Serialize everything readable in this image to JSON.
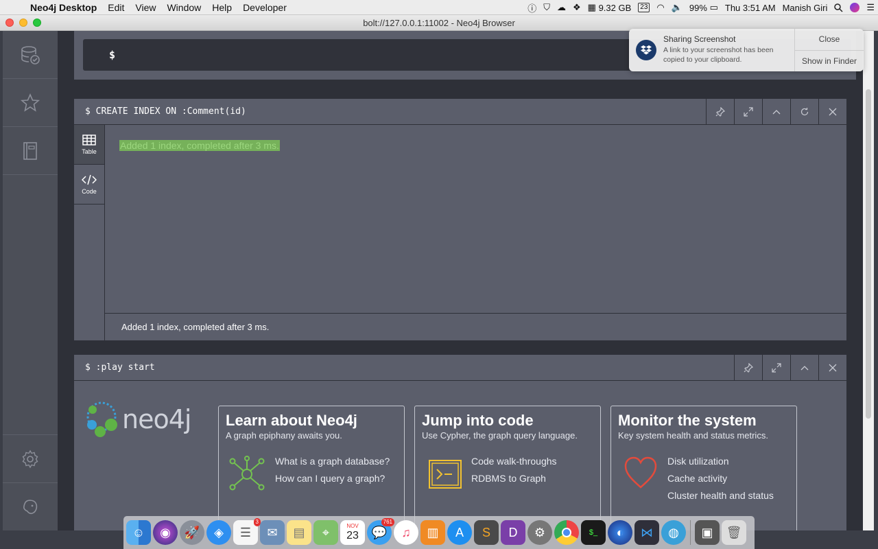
{
  "menubar": {
    "app_name": "Neo4j Desktop",
    "menus": [
      "Edit",
      "View",
      "Window",
      "Help",
      "Developer"
    ],
    "memory": "9.32 GB",
    "calendar_day": "23",
    "battery": "99%",
    "clock": "Thu 3:51 AM",
    "user": "Manish Giri"
  },
  "window": {
    "title": "bolt://127.0.0.1:11002 - Neo4j Browser"
  },
  "editor": {
    "prompt": "$"
  },
  "frames": [
    {
      "command": "$ CREATE INDEX ON :Comment(id)",
      "tabs": [
        {
          "label": "Table"
        },
        {
          "label": "Code"
        }
      ],
      "result": "Added 1 index, completed after 3 ms.",
      "status": "Added 1 index, completed after 3 ms."
    },
    {
      "command": "$ :play start",
      "logo": "neo4j",
      "cards": [
        {
          "title": "Learn about Neo4j",
          "subtitle": "A graph epiphany awaits you.",
          "links": [
            "What is a graph database?",
            "How can I query a graph?"
          ]
        },
        {
          "title": "Jump into code",
          "subtitle": "Use Cypher, the graph query language.",
          "links": [
            "Code walk-throughs",
            "RDBMS to Graph"
          ]
        },
        {
          "title": "Monitor the system",
          "subtitle": "Key system health and status metrics.",
          "links": [
            "Disk utilization",
            "Cache activity",
            "Cluster health and status"
          ]
        }
      ]
    }
  ],
  "notification": {
    "title": "Sharing Screenshot",
    "body": "A link to your screenshot has been copied to your clipboard.",
    "close": "Close",
    "show": "Show in Finder"
  },
  "dock": {
    "reminders_badge": "3",
    "calendar_month": "NOV",
    "calendar_day": "23",
    "messages_badge": "761"
  },
  "colors": {
    "accent_green": "#76b15a",
    "frame_bg": "#5b5e6b",
    "app_bg": "#2e3038"
  }
}
